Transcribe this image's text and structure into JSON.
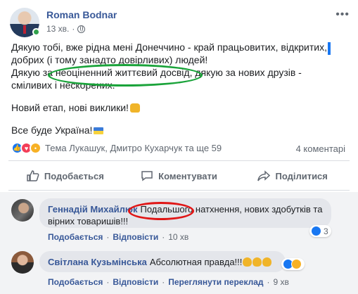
{
  "post": {
    "author": "Roman Bodnar",
    "time": "13 хв.",
    "more_icon": "more-horizontal-icon",
    "privacy_icon": "globe-icon",
    "text": {
      "line1": "Дякую тобі, вже рідна мені Донеччино - край працьовитих, відкритих,",
      "line2": "добрих (і тому занадто довірливих) людей!",
      "line3": "Дякую за неоціненний життєвий досвід, дякую за нових друзів -",
      "line4": "сміливих і нескорених.",
      "para2": "Новий етап, нові виклики!",
      "para3": "Все буде Україна!"
    },
    "reactions_text": "Тема Лукашук, Дмитро Кухарчук та ще 59",
    "comments_count": "4 коментарі"
  },
  "actions": {
    "like": "Подобається",
    "comment": "Коментувати",
    "share": "Поділитися"
  },
  "comments": [
    {
      "name": "Геннадій Михайлюк",
      "text": "Подальшого натхнення, нових здобутків та вірних товаришів!!!",
      "like": "Подобається",
      "reply": "Відповісти",
      "time": "10 хв",
      "reactions": "3"
    },
    {
      "name": "Світлана Кузьмінська",
      "text": "Абсолютная правда!!!",
      "like": "Подобається",
      "reply": "Відповісти",
      "translate": "Переглянути переклад",
      "time": "9 хв"
    }
  ],
  "colors": {
    "link_blue": "#385898",
    "annotation_green": "#1aa33a",
    "annotation_red": "#e01616"
  }
}
